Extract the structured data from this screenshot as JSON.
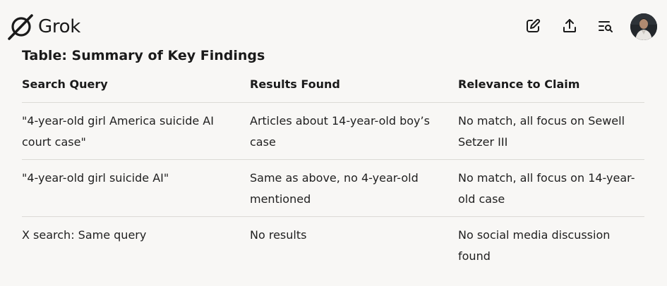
{
  "app": {
    "name": "Grok"
  },
  "header_icons": [
    "edit-icon",
    "share-upload-icon",
    "search-history-icon"
  ],
  "table": {
    "title": "Table: Summary of Key Findings",
    "columns": [
      "Search Query",
      "Results Found",
      "Relevance to Claim"
    ],
    "rows": [
      [
        "\"4-year-old girl America suicide AI court case\"",
        "Articles about 14-year-old boy’s case",
        "No match, all focus on Sewell Setzer III"
      ],
      [
        "\"4-year-old girl suicide AI\"",
        "Same as above, no 4-year-old mentioned",
        "No match, all focus on 14-year-old case"
      ],
      [
        "X search: Same query",
        "No results",
        "No social media discussion found"
      ]
    ]
  }
}
